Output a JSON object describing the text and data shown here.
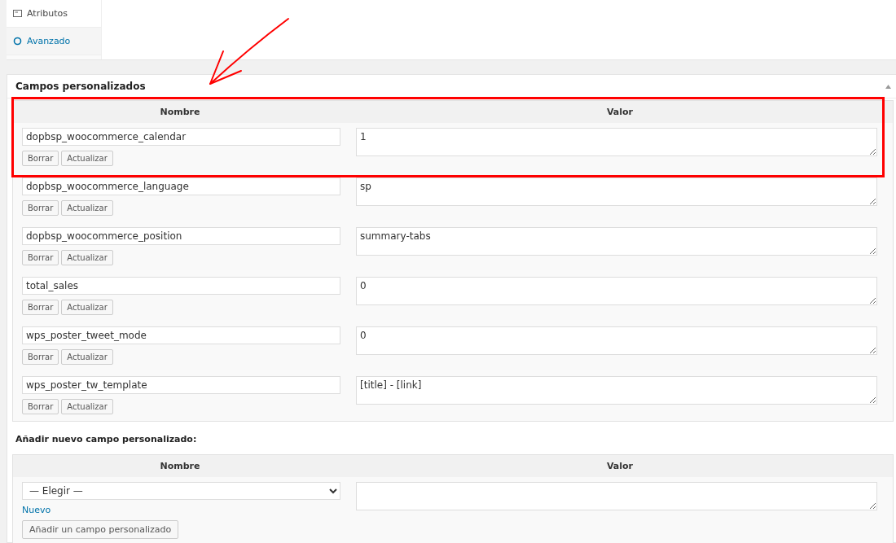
{
  "tabs": [
    {
      "label": "Atributos",
      "kind": "attributes"
    },
    {
      "label": "Avanzado",
      "kind": "advanced"
    }
  ],
  "custom_fields": {
    "title": "Campos personalizados",
    "columns": [
      "Nombre",
      "Valor"
    ],
    "rows": [
      {
        "name": "dopbsp_woocommerce_calendar",
        "value": "1",
        "delete_label": "Borrar",
        "update_label": "Actualizar",
        "highlighted": true
      },
      {
        "name": "dopbsp_woocommerce_language",
        "value": "sp",
        "delete_label": "Borrar",
        "update_label": "Actualizar",
        "highlighted": false
      },
      {
        "name": "dopbsp_woocommerce_position",
        "value": "summary-tabs",
        "delete_label": "Borrar",
        "update_label": "Actualizar",
        "highlighted": false
      },
      {
        "name": "total_sales",
        "value": "0",
        "delete_label": "Borrar",
        "update_label": "Actualizar",
        "highlighted": false
      },
      {
        "name": "wps_poster_tweet_mode",
        "value": "0",
        "delete_label": "Borrar",
        "update_label": "Actualizar",
        "highlighted": false
      },
      {
        "name": "wps_poster_tw_template",
        "value": "[title] - [link]",
        "delete_label": "Borrar",
        "update_label": "Actualizar",
        "highlighted": false
      }
    ]
  },
  "new_field": {
    "title": "Añadir nuevo campo personalizado:",
    "columns": [
      "Nombre",
      "Valor"
    ],
    "select": "— Elegir —",
    "new_link": "Nuevo",
    "add_button": "Añadir un campo personalizado"
  },
  "annotation": {
    "color": "#ff0000"
  }
}
